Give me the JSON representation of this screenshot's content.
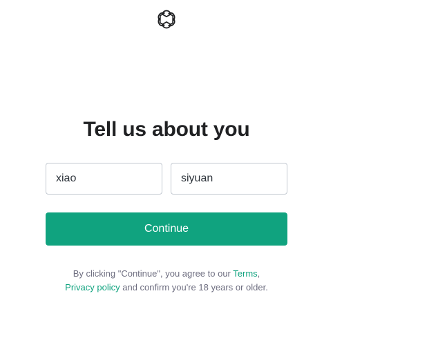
{
  "logo": {
    "icon": "openai-logo-icon"
  },
  "heading": "Tell us about you",
  "form": {
    "first_name_value": "xiao",
    "last_name_value": "siyuan",
    "continue_label": "Continue"
  },
  "legal": {
    "prefix": "By clicking \"Continue\", you agree to our ",
    "terms_link": "Terms",
    "comma": ",",
    "privacy_link": "Privacy policy",
    "suffix": " and confirm you're 18 years or older."
  },
  "colors": {
    "accent": "#10a37f",
    "heading": "#202123",
    "muted": "#6e6e80",
    "border": "#c2c8d0"
  }
}
